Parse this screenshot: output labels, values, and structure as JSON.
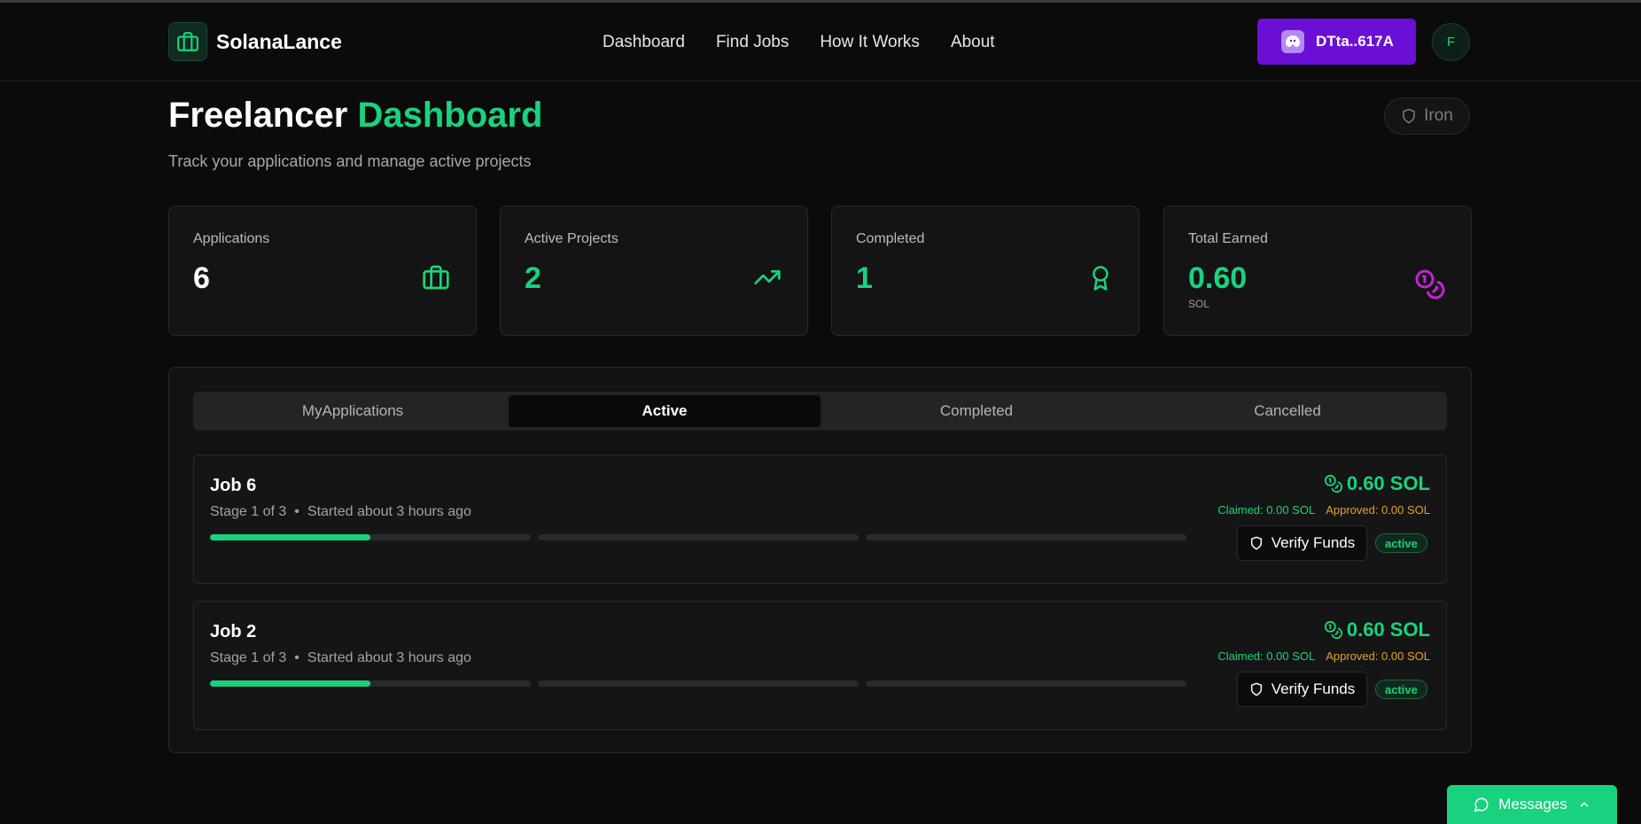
{
  "brand": {
    "name": "SolanaLance"
  },
  "nav": {
    "items": [
      "Dashboard",
      "Find Jobs",
      "How It Works",
      "About"
    ]
  },
  "wallet": {
    "label": "DTta..617A"
  },
  "user": {
    "initial": "F"
  },
  "header": {
    "title_part1": "Freelancer",
    "title_part2": "Dashboard",
    "subtitle": "Track your applications and manage active projects"
  },
  "tier": {
    "label": "Iron"
  },
  "stats": [
    {
      "label": "Applications",
      "value": "6",
      "unit": "",
      "icon": "briefcase-icon",
      "color": "#ffffff"
    },
    {
      "label": "Active Projects",
      "value": "2",
      "unit": "",
      "icon": "trending-up-icon",
      "color": "#19d27f"
    },
    {
      "label": "Completed",
      "value": "1",
      "unit": "",
      "icon": "award-icon",
      "color": "#19d27f"
    },
    {
      "label": "Total Earned",
      "value": "0.60",
      "unit": "SOL",
      "icon": "coins-icon",
      "color": "#19d27f"
    }
  ],
  "tabs": [
    {
      "label": "MyApplications",
      "active": false
    },
    {
      "label": "Active",
      "active": true
    },
    {
      "label": "Completed",
      "active": false
    },
    {
      "label": "Cancelled",
      "active": false
    }
  ],
  "jobs": [
    {
      "title": "Job 6",
      "stage": "Stage 1 of 3",
      "started": "Started about 3 hours ago",
      "amount": "0.60 SOL",
      "claimed": "Claimed: 0.00 SOL",
      "approved": "Approved: 0.00 SOL",
      "verify_label": "Verify Funds",
      "status": "active",
      "stage_progress": [
        0.5,
        0,
        0
      ]
    },
    {
      "title": "Job 2",
      "stage": "Stage 1 of 3",
      "started": "Started about 3 hours ago",
      "amount": "0.60 SOL",
      "claimed": "Claimed: 0.00 SOL",
      "approved": "Approved: 0.00 SOL",
      "verify_label": "Verify Funds",
      "status": "active",
      "stage_progress": [
        0.5,
        0,
        0
      ]
    }
  ],
  "messages": {
    "label": "Messages"
  },
  "colors": {
    "accent": "#19d27f",
    "wallet": "#6b0fd6",
    "approved": "#e6a02a",
    "coins": "#c026d3"
  }
}
